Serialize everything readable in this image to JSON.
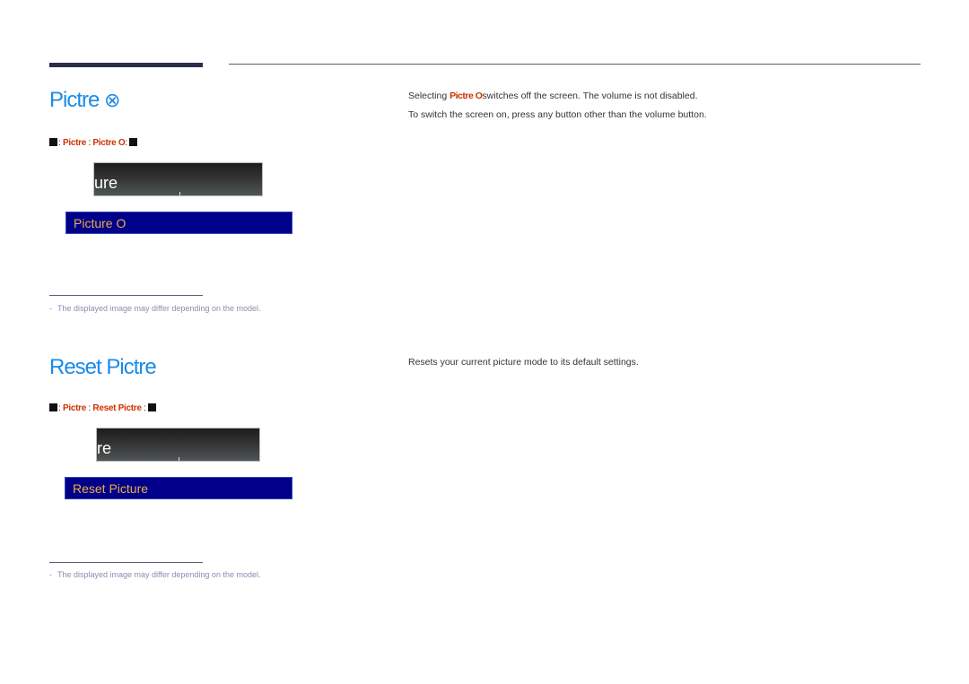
{
  "sections": [
    {
      "title": "Pictre",
      "title_glyph": "⊗",
      "path": {
        "prefix": "MENU",
        "sep1": ":",
        "item1": "Pictre",
        "sep2": " : ",
        "item2": "Pictre O",
        "sep3": ":",
        "suffix": "ENTER"
      },
      "osd_dark_text": "ure",
      "osd_highlight": "Picture O",
      "note": "The displayed image may differ depending on the model.",
      "note_dash": "-",
      "description": {
        "line1_before": "Selecting ",
        "line1_red": "Pictre O",
        "line1_after": "switches off the screen. The volume is not disabled.",
        "line2": "To switch the screen on, press any button other than the volume button."
      }
    },
    {
      "title": "Reset Pictre",
      "path": {
        "prefix": "MENU",
        "sep1": ":",
        "item1": "Pictre",
        "sep2": " : ",
        "item2": "Reset Pictre",
        "sep3": " :",
        "suffix": "ENTER"
      },
      "osd_dark_text": "re",
      "osd_highlight": "Reset Picture",
      "note": "The displayed image may differ depending on the model.",
      "note_dash": "-",
      "description": {
        "line1": "Resets your current picture mode to its default settings."
      }
    }
  ],
  "colors": {
    "title_blue": "#1b8be8",
    "menu_red": "#cc3300",
    "osd_blue": "#00008b",
    "osd_label_gold": "#e8b040",
    "rule_navy": "#2b2e4a"
  }
}
